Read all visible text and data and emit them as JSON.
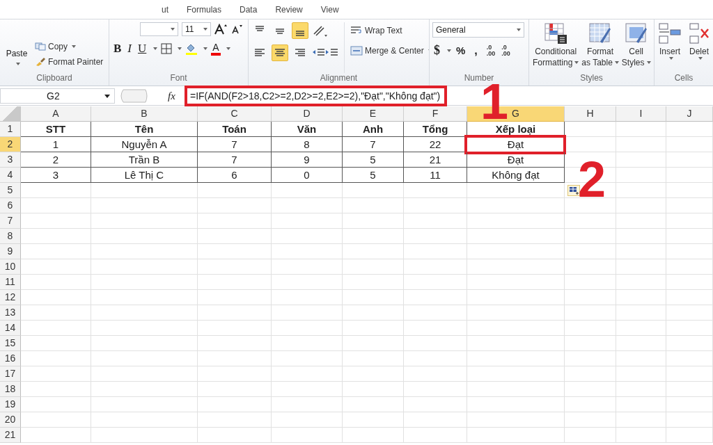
{
  "ribbon": {
    "tabs": [
      {
        "label": "ut",
        "selected": false
      },
      {
        "label": "Formulas",
        "selected": false
      },
      {
        "label": "Data",
        "selected": false
      },
      {
        "label": "Review",
        "selected": false
      },
      {
        "label": "View",
        "selected": false
      }
    ],
    "clipboard": {
      "paste": "Paste",
      "copy": "Copy",
      "format_painter": "Format Painter",
      "label": "Clipboard"
    },
    "font": {
      "size": "11",
      "bold": "B",
      "italic": "I",
      "underline": "U",
      "font_color": "A",
      "label": "Font"
    },
    "alignment": {
      "vertical": [
        {
          "kind": "top",
          "selected": false
        },
        {
          "kind": "middle",
          "selected": false
        },
        {
          "kind": "bottom",
          "selected": true
        }
      ],
      "horizontal": [
        {
          "kind": "left",
          "selected": false
        },
        {
          "kind": "center",
          "selected": true
        },
        {
          "kind": "right",
          "selected": false
        }
      ],
      "wrap_text": "Wrap Text",
      "merge_center": "Merge & Center",
      "label": "Alignment"
    },
    "number": {
      "format": "General",
      "currency": "$",
      "percent": "%",
      "comma": ",",
      "decimals": [
        {
          "top": ".0",
          "bottom": ".00"
        },
        {
          "top": ".0",
          "bottom": ".00"
        }
      ],
      "label": "Number"
    },
    "styles": {
      "buttons": [
        {
          "kind": "conditional",
          "line1": "Conditional",
          "line2": "Formatting"
        },
        {
          "kind": "table",
          "line1": "Format",
          "line2": "as Table"
        },
        {
          "kind": "cell",
          "line1": "Cell",
          "line2": "Styles"
        }
      ],
      "label": "Styles"
    },
    "cells": {
      "buttons": [
        {
          "kind": "insert",
          "label": "Insert"
        },
        {
          "kind": "delete",
          "label": "Delet"
        }
      ],
      "label": "Cells"
    }
  },
  "formula_bar": {
    "name_box": "G2",
    "function_symbol": "fx",
    "formula": "=IF(AND(F2>18,C2>=2,D2>=2,E2>=2),\"Đạt\",\"Không đạt\")"
  },
  "sheet": {
    "columns": [
      {
        "label": "A",
        "selected": false
      },
      {
        "label": "B",
        "selected": false
      },
      {
        "label": "C",
        "selected": false
      },
      {
        "label": "D",
        "selected": false
      },
      {
        "label": "E",
        "selected": false
      },
      {
        "label": "F",
        "selected": false
      },
      {
        "label": "G",
        "selected": true
      },
      {
        "label": "H",
        "selected": false
      },
      {
        "label": "I",
        "selected": false
      },
      {
        "label": "J",
        "selected": false
      }
    ],
    "rows": [
      {
        "number": "1",
        "selected": false,
        "cells": [
          "STT",
          "Tên",
          "Toán",
          "Văn",
          "Anh",
          "Tổng",
          "Xếp loại"
        ]
      },
      {
        "number": "2",
        "selected": true,
        "cells": [
          "1",
          "Nguyễn A",
          "7",
          "8",
          "7",
          "22",
          "Đạt"
        ]
      },
      {
        "number": "3",
        "selected": false,
        "cells": [
          "2",
          "Trần B",
          "7",
          "9",
          "5",
          "21",
          "Đạt"
        ]
      },
      {
        "number": "4",
        "selected": false,
        "cells": [
          "3",
          "Lê Thị C",
          "6",
          "0",
          "5",
          "11",
          "Không đạt"
        ]
      },
      {
        "number": "5",
        "selected": false,
        "cells": []
      },
      {
        "number": "6",
        "selected": false,
        "cells": []
      },
      {
        "number": "7",
        "selected": false,
        "cells": []
      },
      {
        "number": "8",
        "selected": false,
        "cells": []
      },
      {
        "number": "9",
        "selected": false,
        "cells": []
      },
      {
        "number": "10",
        "selected": false,
        "cells": []
      },
      {
        "number": "11",
        "selected": false,
        "cells": []
      },
      {
        "number": "12",
        "selected": false,
        "cells": []
      },
      {
        "number": "13",
        "selected": false,
        "cells": []
      },
      {
        "number": "14",
        "selected": false,
        "cells": []
      },
      {
        "number": "15",
        "selected": false,
        "cells": []
      },
      {
        "number": "16",
        "selected": false,
        "cells": []
      },
      {
        "number": "17",
        "selected": false,
        "cells": []
      },
      {
        "number": "18",
        "selected": false,
        "cells": []
      },
      {
        "number": "19",
        "selected": false,
        "cells": []
      },
      {
        "number": "20",
        "selected": false,
        "cells": []
      },
      {
        "number": "21",
        "selected": false,
        "cells": []
      }
    ]
  },
  "annotations": [
    {
      "kind": "formula",
      "label": "1"
    },
    {
      "kind": "cell",
      "label": "2"
    }
  ]
}
